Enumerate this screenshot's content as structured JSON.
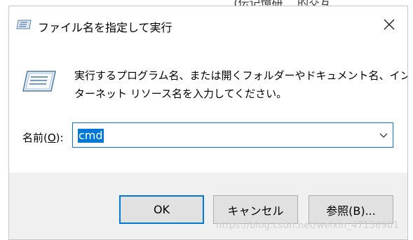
{
  "dialog": {
    "title": "ファイル名を指定して実行",
    "description_line1": "実行するプログラム名、または開くフォルダーやドキュメント名、イン",
    "description_line2": "ターネット リソース名を入力してください。",
    "open_label_prefix": "名前(",
    "open_label_key": "O",
    "open_label_suffix": "):",
    "open_value": "cmd"
  },
  "buttons": {
    "ok": "OK",
    "cancel": "キャンセル",
    "browse": "参照(B)..."
  },
  "background_text": "_ ... (伝记憶研... 的交互... ",
  "watermark": "https://blog.csdn.net/weixin_47156901",
  "colors": {
    "accent": "#0078d7",
    "footer_bg": "#f0f0f0",
    "button_bg": "#e1e1e1"
  },
  "icons": {
    "title": "run-icon",
    "main": "run-icon",
    "close": "close-icon",
    "dropdown": "chevron-down-icon"
  }
}
